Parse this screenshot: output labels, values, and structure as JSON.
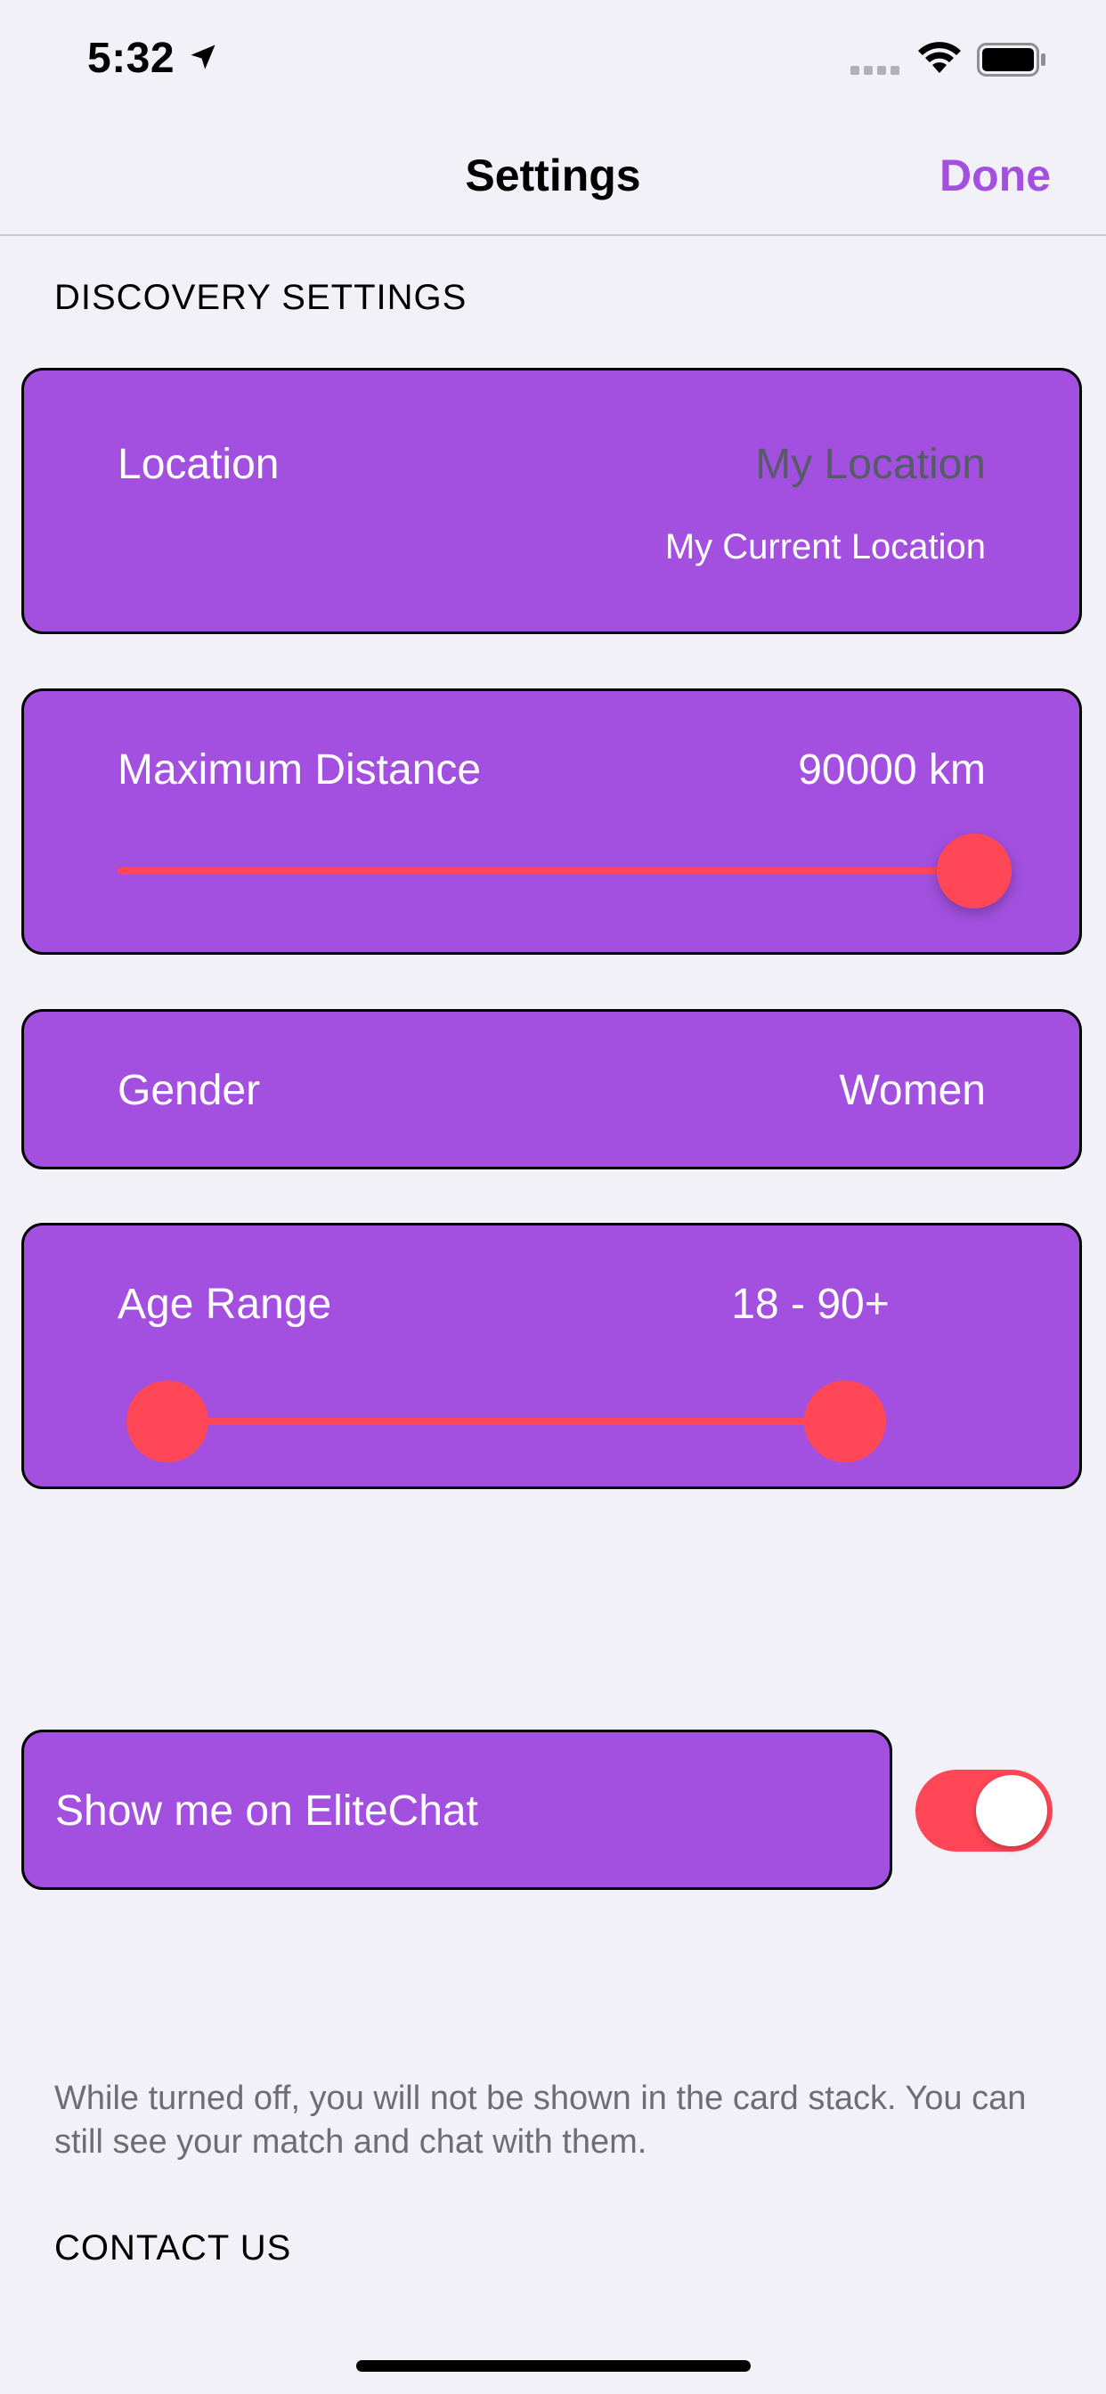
{
  "status_bar": {
    "time": "5:32",
    "icons": [
      "location-arrow-icon",
      "signal-icon",
      "wifi-icon",
      "battery-icon"
    ]
  },
  "nav": {
    "title": "Settings",
    "done_label": "Done"
  },
  "discovery": {
    "header": "DISCOVERY SETTINGS",
    "location": {
      "label": "Location",
      "value": "My Location",
      "subvalue": "My Current Location"
    },
    "max_distance": {
      "label": "Maximum Distance",
      "value": "90000 km",
      "slider_fraction": 1.0
    },
    "gender": {
      "label": "Gender",
      "value": "Women"
    },
    "age_range": {
      "label": "Age Range",
      "value": "18 - 90+",
      "min_fraction": 0.0,
      "max_fraction": 1.0
    }
  },
  "visibility": {
    "label": "Show me on EliteChat",
    "toggle_on": true,
    "footnote": "While turned off, you will not be shown in the card stack. You can still see your match and chat with them."
  },
  "contact": {
    "header": "CONTACT US"
  },
  "colors": {
    "accent": "#a350e0",
    "slider": "#ff4757",
    "background": "#f2f1f7"
  }
}
